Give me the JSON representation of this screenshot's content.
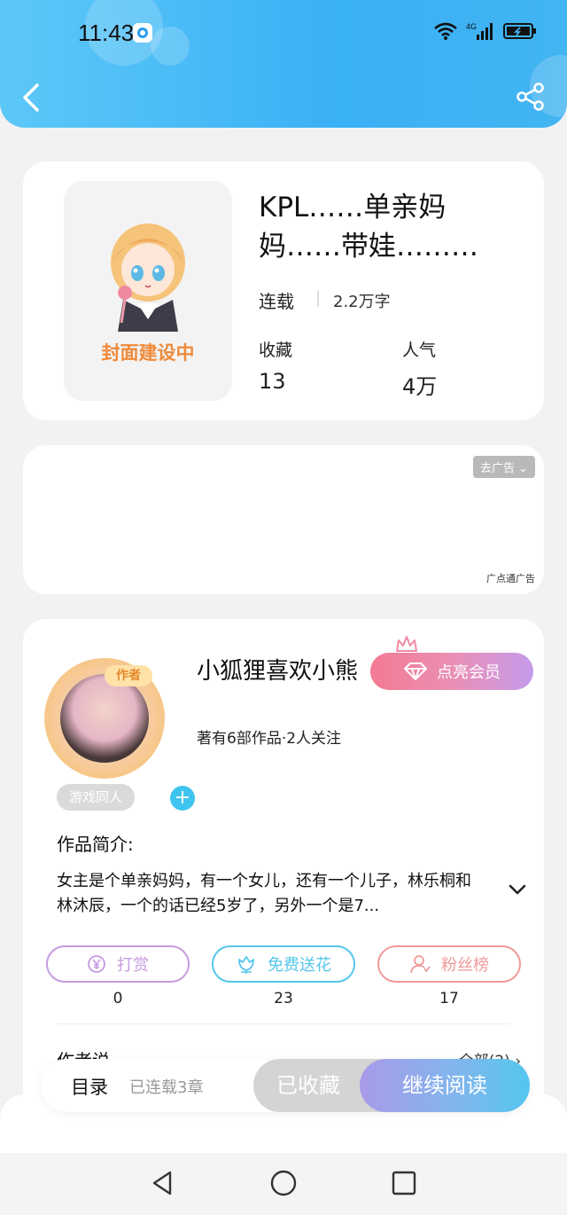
{
  "status_bar": {
    "time": "11:43",
    "network": "4G"
  },
  "header": {
    "back_icon": "chevron-left-icon",
    "share_icon": "share-icon"
  },
  "book": {
    "cover_placeholder": "封面建设中",
    "title": "KPL……单亲妈妈……带娃………",
    "status": "连载",
    "word_count": "2.2万字",
    "stats": [
      {
        "label": "收藏",
        "value": "13"
      },
      {
        "label": "人气",
        "value": "4万"
      }
    ]
  },
  "ad": {
    "remove_label": "去广告",
    "source": "广点通广告"
  },
  "author": {
    "badge": "作者",
    "name": "小狐狸喜欢小熊",
    "vip_label": "点亮会员",
    "meta": "著有6部作品·2人关注",
    "tag": "游戏同人",
    "intro_label": "作品简介:",
    "intro_text": "女主是个单亲妈妈，有一个女儿，还有一个儿子，林乐桐和 林沐辰，一个的话已经5岁了，另外一个是7...",
    "actions": [
      {
        "label": "打赏",
        "count": "0",
        "icon": "yen-icon",
        "color": "#c59be0"
      },
      {
        "label": "免费送花",
        "count": "23",
        "icon": "flower-icon",
        "color": "#55c6ec"
      },
      {
        "label": "粉丝榜",
        "count": "17",
        "icon": "fans-icon",
        "color": "#ef9a9a"
      }
    ],
    "author_says_label": "作者说",
    "all_label": "全部(2)"
  },
  "bottom_bar": {
    "catalog_label": "目录",
    "chapters_label": "已连载3章",
    "favorited_label": "已收藏",
    "continue_label": "继续阅读"
  }
}
